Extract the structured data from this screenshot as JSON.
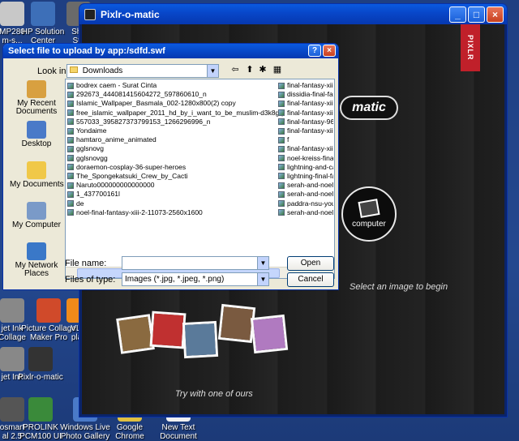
{
  "desktop": {
    "icons": [
      {
        "label": "MP280\nm-s...",
        "color": "#c8c8c8"
      },
      {
        "label": "HP Solution\nCenter",
        "color": "#3d6fb8"
      },
      {
        "label": "Sho\nSta",
        "color": "#6a6a6a"
      },
      {
        "label": "jet Ink\nCollage",
        "color": "#888"
      },
      {
        "label": "Picture Collage\nMaker Pro",
        "color": "#d04a2a"
      },
      {
        "label": "VLC\nplay",
        "color": "#f08a1a"
      },
      {
        "label": "jet Ink",
        "color": "#888"
      },
      {
        "label": "Pixlr-o-matic",
        "color": "#333"
      },
      {
        "label": "osmart\nal 2.5",
        "color": "#555"
      },
      {
        "label": "PROLINK\nPCM100 UI",
        "color": "#3a8a3a"
      },
      {
        "label": "Windows Live\nPhoto Gallery",
        "color": "#4a7ac8"
      },
      {
        "label": "Google\nChrome",
        "color": "#e0c040"
      },
      {
        "label": "New Text\nDocument",
        "color": "#f0f0f0"
      }
    ]
  },
  "pixlr": {
    "title": "Pixlr-o-matic",
    "ribbon": "PIXLR",
    "logo": "matic",
    "computer_label": "computer",
    "select_hint": "Select an image to begin",
    "try_hint": "Try with one of ours",
    "photo_colors": [
      "#8a6a40",
      "#c03030",
      "#5a7a9a",
      "#7a5a40",
      "#b07ac0"
    ]
  },
  "dialog": {
    "title": "Select file to upload by app:/sdfd.swf",
    "look_in_label": "Look in:",
    "look_in_value": "Downloads",
    "places": [
      {
        "label": "My Recent\nDocuments",
        "icon": "recent-documents-icon",
        "color": "#d8a040"
      },
      {
        "label": "Desktop",
        "icon": "desktop-icon",
        "color": "#4a7ac8"
      },
      {
        "label": "My Documents",
        "icon": "my-documents-icon",
        "color": "#f0c848"
      },
      {
        "label": "My Computer",
        "icon": "my-computer-icon",
        "color": "#7a9ac8"
      },
      {
        "label": "My Network\nPlaces",
        "icon": "network-places-icon",
        "color": "#3a78c8"
      }
    ],
    "files_col1": [
      {
        "name": "bodrex caem - Surat Cinta",
        "folder": false
      },
      {
        "name": "292673_444081415604272_597860610_n",
        "folder": false
      },
      {
        "name": "Islamic_Wallpaper_Basmala_002-1280x800(2) copy",
        "folder": false
      },
      {
        "name": "free_islamic_wallpaper_2011_hd_by_i_want_to_be_muslim-d3k8gq",
        "folder": false
      },
      {
        "name": "557033_395827373799153_1266296996_n",
        "folder": false
      },
      {
        "name": "Yondaime",
        "folder": false
      },
      {
        "name": "hamtaro_anime_animated",
        "folder": false
      },
      {
        "name": "gglsnovg",
        "folder": false
      },
      {
        "name": "gglsnovgg",
        "folder": false
      },
      {
        "name": "doraemon-cosplay-36-super-heroes",
        "folder": false
      },
      {
        "name": "The_Spongekatsuki_Crew_by_Cacti",
        "folder": false
      },
      {
        "name": "Naruto000000000000000",
        "folder": false
      },
      {
        "name": "1_437700161l",
        "folder": false
      },
      {
        "name": "de",
        "folder": false
      },
      {
        "name": "noel-final-fantasy-xiii-2-11073-2560x1600",
        "folder": false
      }
    ],
    "files_col2": [
      "final-fantasy-xiii",
      "dissidia-final-fan",
      "final-fantasy-xiii",
      "final-fantasy-xiii",
      "final-fantasy-96",
      "final-fantasy-xiii",
      "f",
      "final-fantasy-xiii",
      "noel-kreiss-final",
      "lightning-and-ca",
      "lightning-final-fa",
      "serah-and-noel-",
      "serah-and-noel-",
      "paddra-nsu-you",
      "serah-and-noel-"
    ],
    "file_name_label": "File name:",
    "file_name_value": "",
    "files_of_type_label": "Files of type:",
    "files_of_type_value": "Images (*.jpg, *.jpeg, *.png)",
    "open_label": "Open",
    "cancel_label": "Cancel"
  }
}
